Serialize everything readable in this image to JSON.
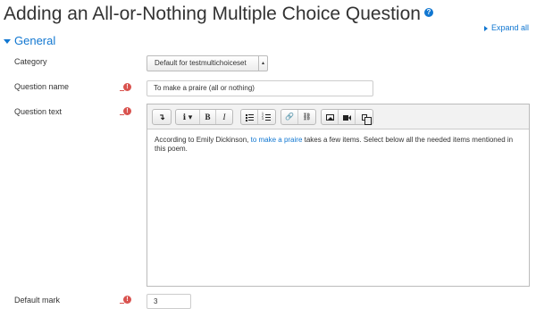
{
  "page": {
    "title": "Adding an All-or-Nothing Multiple Choice Question",
    "expand_all": "Expand all"
  },
  "section": {
    "title": "General"
  },
  "fields": {
    "category": {
      "label": "Category",
      "value": "Default for testmultichoiceset"
    },
    "question_name": {
      "label": "Question name",
      "value": "To make a praire (all or nothing)",
      "required": true
    },
    "question_text": {
      "label": "Question text",
      "required": true,
      "content_before": "According to Emily Dickinson, ",
      "content_link": "to make a praire",
      "content_after": " takes a few items. Select below all the needed items mentioned in this poem."
    },
    "default_mark": {
      "label": "Default mark",
      "value": "3",
      "required": true
    }
  },
  "toolbar": {
    "buttons": [
      {
        "name": "show-more-icon",
        "glyph": "↴"
      },
      {
        "name": "info-style-icon",
        "glyph": "ℹ ▾"
      },
      {
        "name": "bold-icon",
        "glyph": "B"
      },
      {
        "name": "italic-icon",
        "glyph": "I"
      },
      {
        "name": "unordered-list-icon",
        "glyph": ""
      },
      {
        "name": "ordered-list-icon",
        "glyph": ""
      },
      {
        "name": "link-icon",
        "glyph": "🔗"
      },
      {
        "name": "unlink-icon",
        "glyph": "⛓"
      },
      {
        "name": "image-icon",
        "glyph": ""
      },
      {
        "name": "media-icon",
        "glyph": ""
      },
      {
        "name": "manage-files-icon",
        "glyph": ""
      }
    ]
  },
  "icons": {
    "help": "?",
    "required": "!"
  },
  "colors": {
    "accent": "#1177d1",
    "required": "#d9534f"
  }
}
